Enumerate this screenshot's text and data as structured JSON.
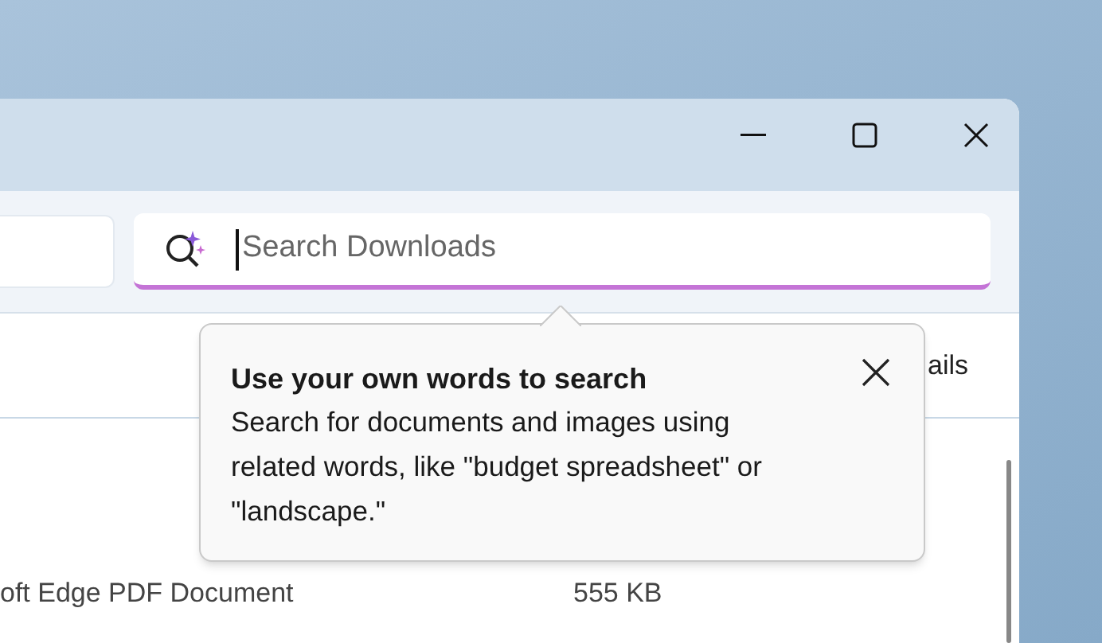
{
  "search": {
    "placeholder": "Search Downloads"
  },
  "command_bar": {
    "label": "ails"
  },
  "file_rows": [
    {
      "type": "oft Edge PDF Document",
      "size": "555 KB"
    }
  ],
  "tooltip": {
    "title": "Use your own words to search",
    "body": "Search for documents and images using related words, like \"budget spreadsheet\" or \"landscape.\""
  }
}
